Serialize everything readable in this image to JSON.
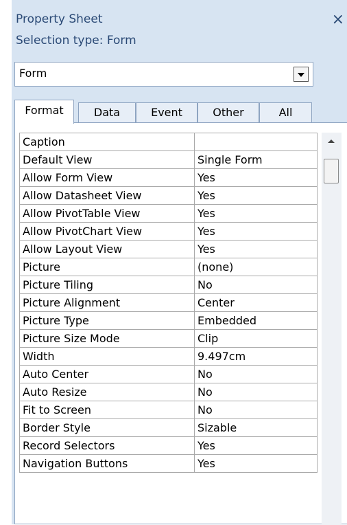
{
  "panel": {
    "title": "Property Sheet",
    "close_icon": "×",
    "selection_type": "Selection type:  Form"
  },
  "object_selector": {
    "value": "Form"
  },
  "tabs": [
    {
      "label": "Format",
      "active": true
    },
    {
      "label": "Data",
      "active": false
    },
    {
      "label": "Event",
      "active": false
    },
    {
      "label": "Other",
      "active": false
    },
    {
      "label": "All",
      "active": false
    }
  ],
  "properties": [
    {
      "name": "Caption",
      "value": ""
    },
    {
      "name": "Default View",
      "value": "Single Form"
    },
    {
      "name": "Allow Form View",
      "value": "Yes"
    },
    {
      "name": "Allow Datasheet View",
      "value": "Yes"
    },
    {
      "name": "Allow PivotTable View",
      "value": "Yes"
    },
    {
      "name": "Allow PivotChart View",
      "value": "Yes"
    },
    {
      "name": "Allow Layout View",
      "value": "Yes"
    },
    {
      "name": "Picture",
      "value": "(none)"
    },
    {
      "name": "Picture Tiling",
      "value": "No"
    },
    {
      "name": "Picture Alignment",
      "value": "Center"
    },
    {
      "name": "Picture Type",
      "value": "Embedded"
    },
    {
      "name": "Picture Size Mode",
      "value": "Clip"
    },
    {
      "name": "Width",
      "value": "9.497cm"
    },
    {
      "name": "Auto Center",
      "value": "No"
    },
    {
      "name": "Auto Resize",
      "value": "No"
    },
    {
      "name": "Fit to Screen",
      "value": "No"
    },
    {
      "name": "Border Style",
      "value": "Sizable"
    },
    {
      "name": "Record Selectors",
      "value": "Yes"
    },
    {
      "name": "Navigation Buttons",
      "value": "Yes"
    }
  ]
}
